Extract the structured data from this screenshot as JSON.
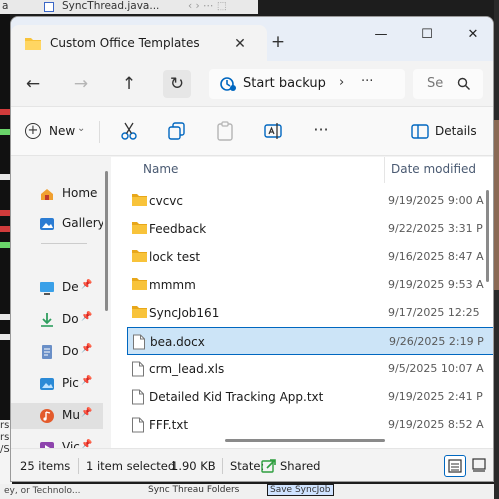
{
  "background": {
    "ide_tab_prefix": "a",
    "ide_tab_title": "SyncThread.java...",
    "ide_tab_nav": "‹  ›  ⋯  ⬚",
    "left_edge_colors": [
      "#d13b3b",
      "#6ad46a",
      "#e8e8e8",
      "#d13b3b",
      "#d13b3b",
      "#6ad46a",
      "#e8e8e8",
      "#e8e8e8"
    ],
    "bottom_left_lines": [
      "rs",
      "rs",
      "/S"
    ],
    "bottom_strip_left": "ey, or Technolo...",
    "bottom_strip_middle": "Sync Threau Folders",
    "bottom_strip_button": "Save SyncJob"
  },
  "window": {
    "tab_title": "Custom Office Templates",
    "tab_close": "✕",
    "new_tab": "+",
    "min": "—",
    "max": "☐",
    "close": "✕"
  },
  "address_bar": {
    "back": "←",
    "forward": "→",
    "up": "↑",
    "refresh": "↻",
    "location": "Start backup",
    "chevron": "›",
    "more": "···",
    "search_placeholder": "Se"
  },
  "toolbar": {
    "new_label": "New",
    "new_dropdown": "⌄",
    "details_label": "Details",
    "icons": [
      "cut-icon",
      "copy-icon",
      "paste-icon",
      "rename-icon",
      "more-options-icon"
    ],
    "more": "···"
  },
  "sidebar": {
    "items": [
      {
        "label": "Home",
        "icon": "home-icon",
        "pinned": false
      },
      {
        "label": "Gallery",
        "icon": "gallery-icon",
        "pinned": false
      },
      {
        "label": "De",
        "icon": "desktop-icon",
        "pinned": true
      },
      {
        "label": "Do",
        "icon": "downloads-icon",
        "pinned": true
      },
      {
        "label": "Do",
        "icon": "documents-icon",
        "pinned": true
      },
      {
        "label": "Pic",
        "icon": "pictures-icon",
        "pinned": true
      },
      {
        "label": "Mu",
        "icon": "music-icon",
        "pinned": true,
        "selected": true
      },
      {
        "label": "Vic",
        "icon": "videos-icon",
        "pinned": true
      }
    ],
    "pin_glyph": "📌"
  },
  "file_list": {
    "columns": {
      "name": "Name",
      "date": "Date modified"
    },
    "sort_arrow": "^",
    "rows": [
      {
        "name": "cvcvc",
        "date": "9/19/2025 9:00 A",
        "type": "folder"
      },
      {
        "name": "Feedback",
        "date": "9/22/2025 3:31 P",
        "type": "folder"
      },
      {
        "name": "lock test",
        "date": "9/16/2025 8:47 A",
        "type": "folder"
      },
      {
        "name": "mmmm",
        "date": "9/19/2025 9:53 A",
        "type": "folder"
      },
      {
        "name": "SyncJob161",
        "date": "9/17/2025 12:25",
        "type": "folder"
      },
      {
        "name": "bea.docx",
        "date": "9/26/2025 2:19 P",
        "type": "file",
        "selected": true
      },
      {
        "name": "crm_lead.xls",
        "date": "9/5/2025 10:07 A",
        "type": "file"
      },
      {
        "name": "Detailed Kid Tracking App.txt",
        "date": "9/19/2025 2:41 P",
        "type": "file"
      },
      {
        "name": "FFF.txt",
        "date": "9/19/2025 8:52 A",
        "type": "file"
      }
    ]
  },
  "status_bar": {
    "item_count": "25 items",
    "selection": "1 item selected",
    "size": "1.90 KB",
    "state_label": "State:",
    "state_value": "Shared"
  },
  "colors": {
    "accent": "#0067c0",
    "selection_bg": "#cce4f7",
    "folder": "#f8c33a",
    "shared_green": "#2e9e3e"
  }
}
